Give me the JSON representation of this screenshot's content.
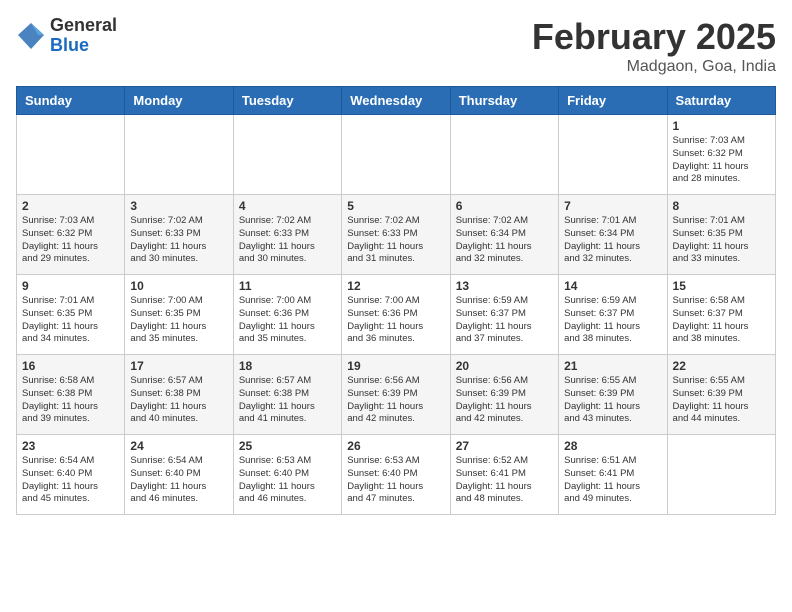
{
  "header": {
    "logo_general": "General",
    "logo_blue": "Blue",
    "month_title": "February 2025",
    "location": "Madgaon, Goa, India"
  },
  "weekdays": [
    "Sunday",
    "Monday",
    "Tuesday",
    "Wednesday",
    "Thursday",
    "Friday",
    "Saturday"
  ],
  "weeks": [
    [
      {
        "day": "",
        "info": ""
      },
      {
        "day": "",
        "info": ""
      },
      {
        "day": "",
        "info": ""
      },
      {
        "day": "",
        "info": ""
      },
      {
        "day": "",
        "info": ""
      },
      {
        "day": "",
        "info": ""
      },
      {
        "day": "1",
        "info": "Sunrise: 7:03 AM\nSunset: 6:32 PM\nDaylight: 11 hours\nand 28 minutes."
      }
    ],
    [
      {
        "day": "2",
        "info": "Sunrise: 7:03 AM\nSunset: 6:32 PM\nDaylight: 11 hours\nand 29 minutes."
      },
      {
        "day": "3",
        "info": "Sunrise: 7:02 AM\nSunset: 6:33 PM\nDaylight: 11 hours\nand 30 minutes."
      },
      {
        "day": "4",
        "info": "Sunrise: 7:02 AM\nSunset: 6:33 PM\nDaylight: 11 hours\nand 30 minutes."
      },
      {
        "day": "5",
        "info": "Sunrise: 7:02 AM\nSunset: 6:33 PM\nDaylight: 11 hours\nand 31 minutes."
      },
      {
        "day": "6",
        "info": "Sunrise: 7:02 AM\nSunset: 6:34 PM\nDaylight: 11 hours\nand 32 minutes."
      },
      {
        "day": "7",
        "info": "Sunrise: 7:01 AM\nSunset: 6:34 PM\nDaylight: 11 hours\nand 32 minutes."
      },
      {
        "day": "8",
        "info": "Sunrise: 7:01 AM\nSunset: 6:35 PM\nDaylight: 11 hours\nand 33 minutes."
      }
    ],
    [
      {
        "day": "9",
        "info": "Sunrise: 7:01 AM\nSunset: 6:35 PM\nDaylight: 11 hours\nand 34 minutes."
      },
      {
        "day": "10",
        "info": "Sunrise: 7:00 AM\nSunset: 6:35 PM\nDaylight: 11 hours\nand 35 minutes."
      },
      {
        "day": "11",
        "info": "Sunrise: 7:00 AM\nSunset: 6:36 PM\nDaylight: 11 hours\nand 35 minutes."
      },
      {
        "day": "12",
        "info": "Sunrise: 7:00 AM\nSunset: 6:36 PM\nDaylight: 11 hours\nand 36 minutes."
      },
      {
        "day": "13",
        "info": "Sunrise: 6:59 AM\nSunset: 6:37 PM\nDaylight: 11 hours\nand 37 minutes."
      },
      {
        "day": "14",
        "info": "Sunrise: 6:59 AM\nSunset: 6:37 PM\nDaylight: 11 hours\nand 38 minutes."
      },
      {
        "day": "15",
        "info": "Sunrise: 6:58 AM\nSunset: 6:37 PM\nDaylight: 11 hours\nand 38 minutes."
      }
    ],
    [
      {
        "day": "16",
        "info": "Sunrise: 6:58 AM\nSunset: 6:38 PM\nDaylight: 11 hours\nand 39 minutes."
      },
      {
        "day": "17",
        "info": "Sunrise: 6:57 AM\nSunset: 6:38 PM\nDaylight: 11 hours\nand 40 minutes."
      },
      {
        "day": "18",
        "info": "Sunrise: 6:57 AM\nSunset: 6:38 PM\nDaylight: 11 hours\nand 41 minutes."
      },
      {
        "day": "19",
        "info": "Sunrise: 6:56 AM\nSunset: 6:39 PM\nDaylight: 11 hours\nand 42 minutes."
      },
      {
        "day": "20",
        "info": "Sunrise: 6:56 AM\nSunset: 6:39 PM\nDaylight: 11 hours\nand 42 minutes."
      },
      {
        "day": "21",
        "info": "Sunrise: 6:55 AM\nSunset: 6:39 PM\nDaylight: 11 hours\nand 43 minutes."
      },
      {
        "day": "22",
        "info": "Sunrise: 6:55 AM\nSunset: 6:39 PM\nDaylight: 11 hours\nand 44 minutes."
      }
    ],
    [
      {
        "day": "23",
        "info": "Sunrise: 6:54 AM\nSunset: 6:40 PM\nDaylight: 11 hours\nand 45 minutes."
      },
      {
        "day": "24",
        "info": "Sunrise: 6:54 AM\nSunset: 6:40 PM\nDaylight: 11 hours\nand 46 minutes."
      },
      {
        "day": "25",
        "info": "Sunrise: 6:53 AM\nSunset: 6:40 PM\nDaylight: 11 hours\nand 46 minutes."
      },
      {
        "day": "26",
        "info": "Sunrise: 6:53 AM\nSunset: 6:40 PM\nDaylight: 11 hours\nand 47 minutes."
      },
      {
        "day": "27",
        "info": "Sunrise: 6:52 AM\nSunset: 6:41 PM\nDaylight: 11 hours\nand 48 minutes."
      },
      {
        "day": "28",
        "info": "Sunrise: 6:51 AM\nSunset: 6:41 PM\nDaylight: 11 hours\nand 49 minutes."
      },
      {
        "day": "",
        "info": ""
      }
    ]
  ]
}
